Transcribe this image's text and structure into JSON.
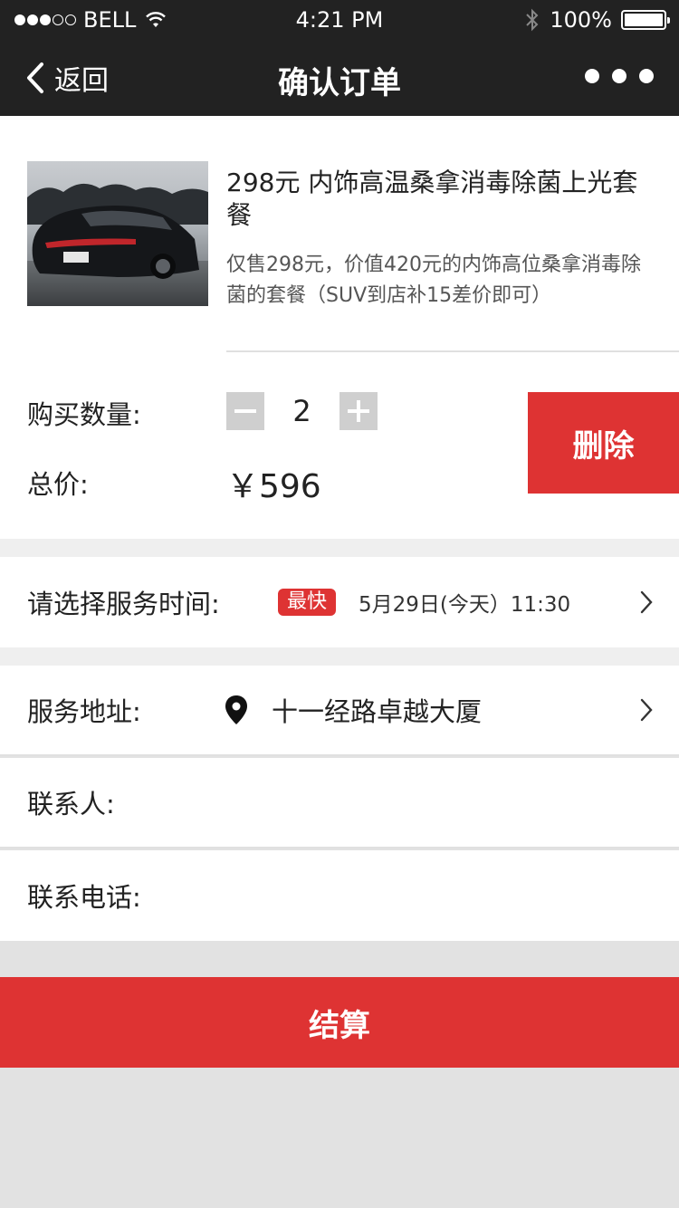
{
  "status_bar": {
    "carrier": "BELL",
    "time": "4:21 PM",
    "battery": "100%",
    "signal_dots": [
      true,
      true,
      true,
      false,
      false
    ]
  },
  "nav": {
    "back_label": "返回",
    "title": "确认订单",
    "more_icon": "more-dots-icon"
  },
  "order": {
    "product_title": "298元 内饰高温桑拿消毒除菌上光套餐",
    "product_desc": "仅售298元，价值420元的内饰高位桑拿消毒除菌的套餐（SUV到店补15差价即可）",
    "quantity_label": "购买数量:",
    "quantity": "2",
    "total_label": "总价:",
    "total_value": "￥596",
    "delete_label": "删除"
  },
  "service_time": {
    "label": "请选择服务时间:",
    "badge": "最快",
    "value": "5月29日(今天）11:30"
  },
  "address": {
    "label": "服务地址:",
    "value": "十一经路卓越大厦"
  },
  "contact": {
    "label": "联系人:"
  },
  "phone": {
    "label": "联系电话:"
  },
  "checkout": {
    "label": "结算"
  },
  "colors": {
    "accent_red": "#de3333",
    "nav_bg": "#222222",
    "page_bg": "#e2e2e2"
  }
}
